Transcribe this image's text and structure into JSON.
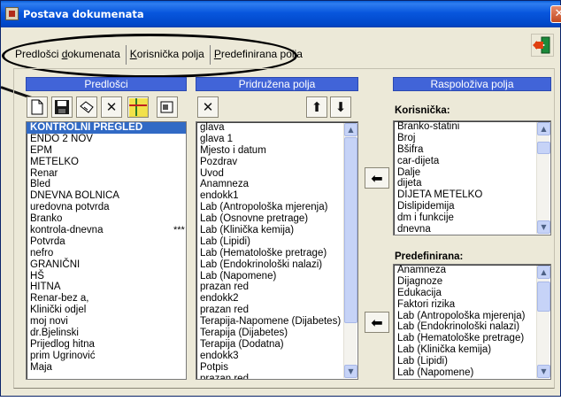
{
  "window": {
    "title": "Postava dokumenata",
    "close_glyph": "✕"
  },
  "tabs": [
    {
      "pre": "Predlošci ",
      "ul": "d",
      "post": "okumenata",
      "active": true
    },
    {
      "pre": "",
      "ul": "K",
      "post": "orisnička polja",
      "active": false
    },
    {
      "pre": "",
      "ul": "P",
      "post": "redefinirana polja",
      "active": false
    }
  ],
  "panels": {
    "templates": {
      "header": "Predlošci",
      "items": [
        {
          "label": "KONTROLNI PREGLED",
          "selected": true,
          "mark": ""
        },
        {
          "label": "ENDO 2 NOV",
          "mark": ""
        },
        {
          "label": "EPM",
          "mark": ""
        },
        {
          "label": "METELKO",
          "mark": ""
        },
        {
          "label": "Renar",
          "mark": ""
        },
        {
          "label": "Bled",
          "mark": ""
        },
        {
          "label": "DNEVNA BOLNICA",
          "mark": ""
        },
        {
          "label": "uredovna potvrda",
          "mark": ""
        },
        {
          "label": "Branko",
          "mark": ""
        },
        {
          "label": "kontrola-dnevna",
          "mark": "***"
        },
        {
          "label": "Potvrda",
          "mark": ""
        },
        {
          "label": "nefro",
          "mark": ""
        },
        {
          "label": "GRANIČNI",
          "mark": ""
        },
        {
          "label": "HŠ",
          "mark": ""
        },
        {
          "label": "HITNA",
          "mark": ""
        },
        {
          "label": "Renar-bez a,",
          "mark": ""
        },
        {
          "label": "Klinički odjel",
          "mark": ""
        },
        {
          "label": "moj novi",
          "mark": ""
        },
        {
          "label": "dr.Bjelinski",
          "mark": ""
        },
        {
          "label": "Prijedlog hitna",
          "mark": ""
        },
        {
          "label": "prim Ugrinović",
          "mark": ""
        },
        {
          "label": "Maja",
          "mark": ""
        }
      ]
    },
    "assigned": {
      "header": "Pridružena polja",
      "items": [
        "glava",
        "glava 1",
        "Mjesto i datum",
        "Pozdrav",
        "Uvod",
        "Anamneza",
        "endokk1",
        "Lab (Antropološka mjerenja)",
        "Lab (Osnovne pretrage)",
        "Lab (Klinička kemija)",
        "Lab (Lipidi)",
        "Lab (Hematološke pretrage)",
        "Lab (Endokrinološki nalazi)",
        "Lab (Napomene)",
        "prazan red",
        "endokk2",
        "prazan red",
        "Terapija-Napomene (Dijabetes)",
        "Terapija (Dijabetes)",
        "Terapija (Dodatna)",
        "endokk3",
        "Potpis",
        "prazan red"
      ]
    },
    "available": {
      "header": "Raspoloživa polja",
      "user_label": "Korisnička:",
      "user_items": [
        "Branko-statini",
        "Broj",
        "Bšifra",
        "car-dijeta",
        "Dalje",
        "dijeta",
        "DIJETA METELKO",
        "Dislipidemija",
        "dm i funkcije",
        "dnevna"
      ],
      "predef_label": "Predefinirana:",
      "predef_items": [
        "Anamneza",
        "Dijagnoze",
        "Edukacija",
        "Faktori rizika",
        "Lab (Antropološka mjerenja)",
        "Lab (Endokrinološki nalazi)",
        "Lab (Hematološke pretrage)",
        "Lab (Klinička kemija)",
        "Lab (Lipidi)",
        "Lab (Napomene)"
      ]
    }
  },
  "glyphs": {
    "delete": "✕",
    "up": "⬆",
    "down": "⬇",
    "left": "⬅",
    "scroll_up": "▲",
    "scroll_down": "▼"
  }
}
